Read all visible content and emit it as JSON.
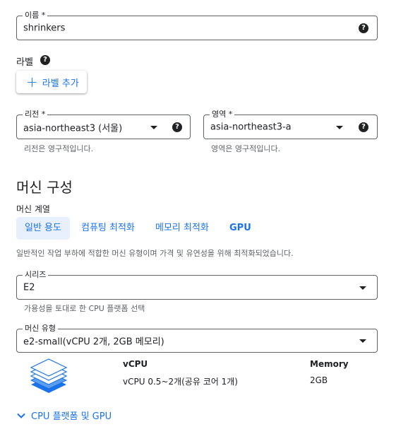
{
  "name_field": {
    "label": "이름 *",
    "value": "shrinkers"
  },
  "labels_section": {
    "title": "라벨",
    "add_button": "라벨 추가"
  },
  "region_field": {
    "label": "리전 *",
    "value": "asia-northeast3 (서울)",
    "hint": "리전은 영구적입니다."
  },
  "zone_field": {
    "label": "영역 *",
    "value": "asia-northeast3-a",
    "hint": "영역은 영구적입니다."
  },
  "machine_config": {
    "title": "머신 구성",
    "family_label": "머신 계열",
    "tabs": [
      {
        "label": "일반 용도",
        "active": true
      },
      {
        "label": "컴퓨팅 최적화",
        "active": false
      },
      {
        "label": "메모리 최적화",
        "active": false
      },
      {
        "label": "GPU",
        "active": false
      }
    ],
    "description": "일반적인 작업 부하에 적합한 머신 유형이며 가격 및 유연성을 위해 최적화되었습니다."
  },
  "series_field": {
    "label": "시리즈",
    "value": "E2",
    "hint": "가용성을 토대로 한 CPU 플랫폼 선택"
  },
  "machine_type_field": {
    "label": "머신 유형",
    "value": "e2-small(vCPU 2개, 2GB 메모리)"
  },
  "spec_table": {
    "headers": {
      "vcpu": "vCPU",
      "memory": "Memory"
    },
    "values": {
      "vcpu": "vCPU 0.5~2개(공유 코어 1개)",
      "memory": "2GB"
    }
  },
  "expand_link": {
    "label": "CPU 플랫폼 및 GPU",
    "icon": "chevron-down-icon"
  },
  "colors": {
    "accent": "#1a73e8",
    "tab_active_bg": "#e8f0fe",
    "text": "#202124",
    "hint": "#5f6368"
  }
}
